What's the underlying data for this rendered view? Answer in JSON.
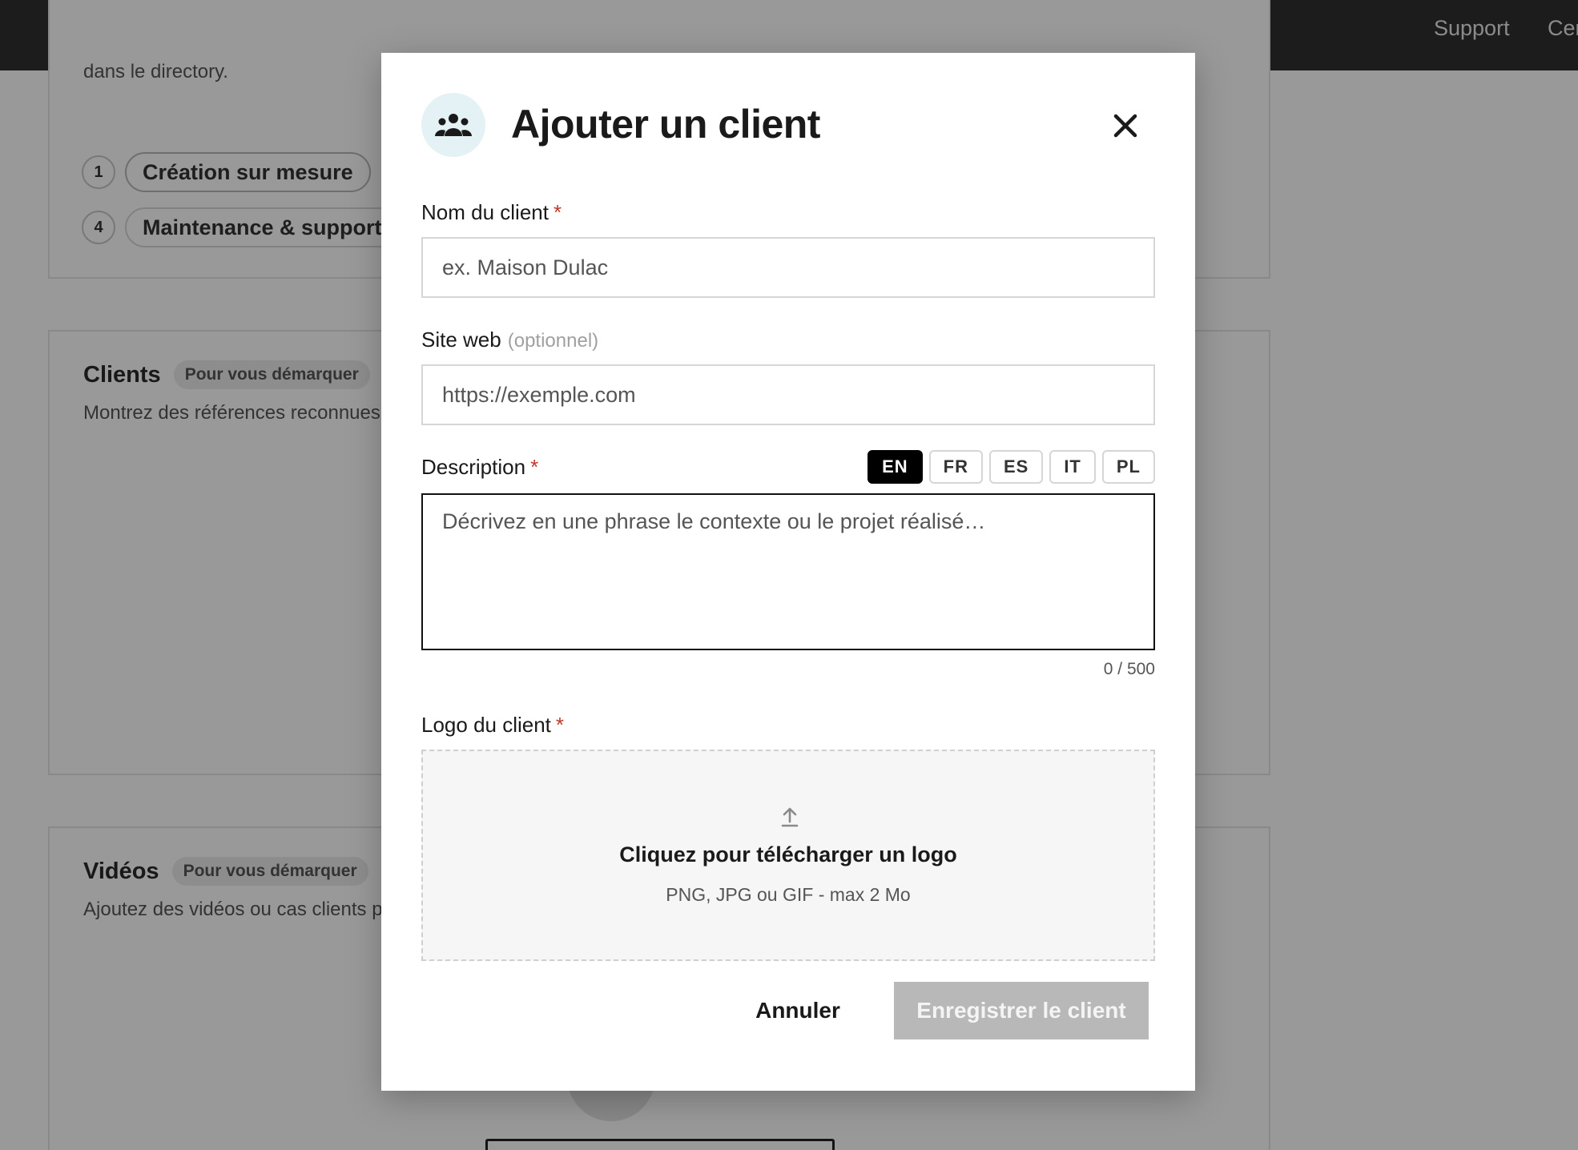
{
  "topnav": {
    "support": "Support",
    "cert": "Cer"
  },
  "background": {
    "intro_text": "dans le directory.",
    "steps": [
      {
        "number": "1",
        "label": "Création sur mesure"
      },
      {
        "number": "4",
        "label": "Maintenance & support"
      }
    ],
    "clients_section": {
      "title": "Clients",
      "badge": "Pour vous démarquer",
      "description": "Montrez des références reconnues"
    },
    "videos_section": {
      "title": "Vidéos",
      "badge": "Pour vous démarquer",
      "description": "Ajoutez des vidéos ou cas clients p"
    }
  },
  "modal": {
    "title": "Ajouter un client",
    "icon": "users-icon",
    "fields": {
      "client_name": {
        "label": "Nom du client",
        "required_mark": "*",
        "placeholder": "ex. Maison Dulac",
        "value": ""
      },
      "website": {
        "label": "Site web",
        "optional_tag": "(optionnel)",
        "placeholder": "https://exemple.com",
        "value": ""
      },
      "description": {
        "label": "Description",
        "required_mark": "*",
        "placeholder": "Décrivez en une phrase le contexte ou le projet réalisé…",
        "value": "",
        "counter": "0 / 500",
        "languages": [
          "EN",
          "FR",
          "ES",
          "IT",
          "PL"
        ],
        "active_language": "EN"
      },
      "logo": {
        "label": "Logo du client",
        "required_mark": "*",
        "upload_title": "Cliquez pour télécharger un logo",
        "upload_hint": "PNG, JPG ou GIF - max 2 Mo"
      }
    },
    "actions": {
      "cancel_label": "Annuler",
      "save_label": "Enregistrer le client"
    }
  },
  "colors": {
    "topbar": "#2f2f2f",
    "required": "#c0392b",
    "active_lang_bg": "#000000",
    "disabled_button": "#b8b8b8",
    "icon_circle": "#e4f2f6"
  }
}
